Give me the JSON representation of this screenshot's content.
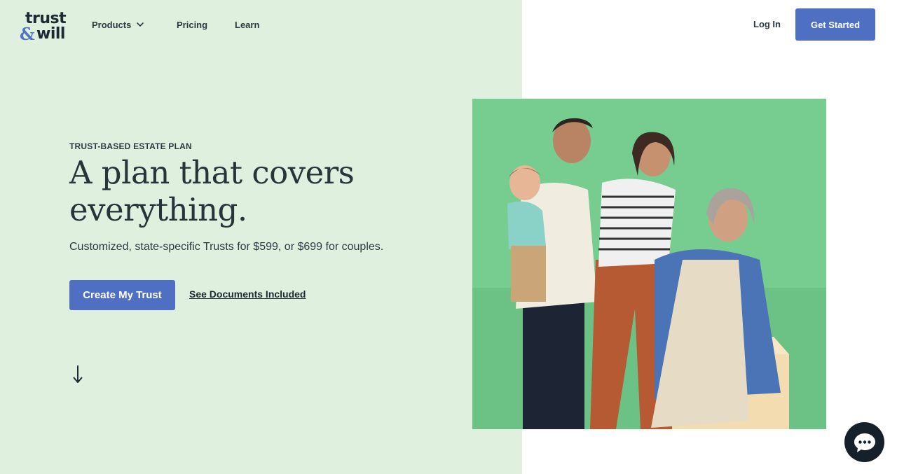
{
  "brand": {
    "line1": "trust",
    "ampersand": "&",
    "line2": "will",
    "accent_color": "#4e6fc2",
    "left_bg": "#e0f0df"
  },
  "nav": {
    "products": "Products",
    "pricing": "Pricing",
    "learn": "Learn",
    "login": "Log In",
    "get_started": "Get Started"
  },
  "hero": {
    "eyebrow": "TRUST-BASED ESTATE PLAN",
    "headline": "A plan that covers everything.",
    "subtext": "Customized, state-specific Trusts for $599, or $699 for couples.",
    "cta_primary": "Create My Trust",
    "cta_secondary": "See Documents Included"
  },
  "icons": {
    "products_chevron": "chevron-down-icon",
    "scroll": "arrow-down-icon",
    "chat": "chat-bubble-icon"
  }
}
